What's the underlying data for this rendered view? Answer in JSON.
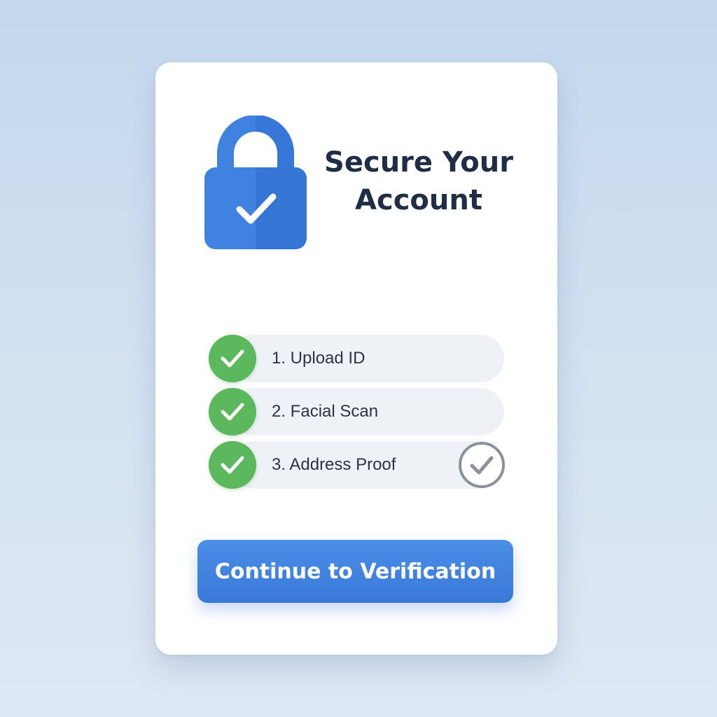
{
  "card": {
    "title_line1": "Secure Your",
    "title_line2": "Account",
    "lock_icon": "padlock-check-icon",
    "accent_color": "#3d7fdc"
  },
  "steps": [
    {
      "label": "1. Upload ID",
      "status": "complete",
      "icon": "check-circle-icon"
    },
    {
      "label": "2. Facial Scan",
      "status": "complete",
      "icon": "check-circle-icon"
    },
    {
      "label": "3. Address Proof",
      "status": "complete",
      "icon": "check-circle-icon",
      "trailing_icon": "outlined-check-circle-icon"
    }
  ],
  "colors": {
    "success": "#5cb85c",
    "button": "#3d7fdc",
    "title": "#1f2d45"
  },
  "button": {
    "label": "Continue to Verification"
  }
}
